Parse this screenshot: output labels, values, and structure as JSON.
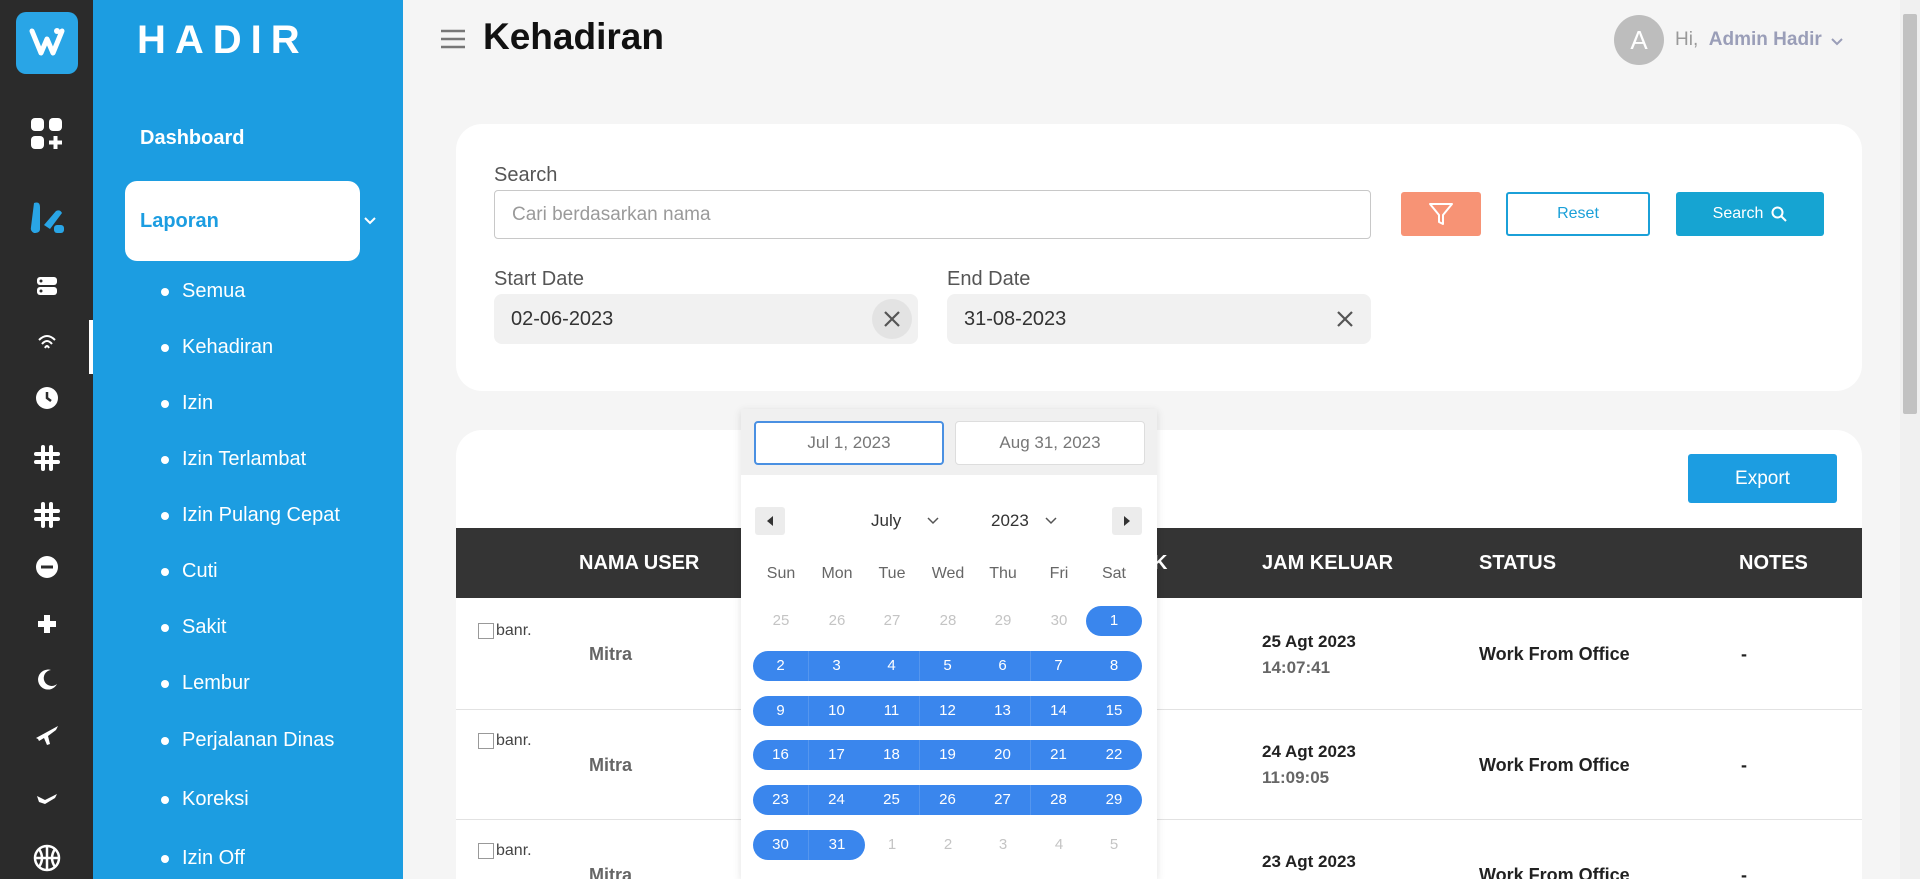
{
  "brand": {
    "name": "HADIR"
  },
  "header": {
    "title": "Kehadiran",
    "avatar_initial": "A",
    "greeting": "Hi,",
    "user_name": "Admin Hadir"
  },
  "menu": {
    "dashboard": "Dashboard",
    "laporan": "Laporan",
    "subitems": [
      "Semua",
      "Kehadiran",
      "Izin",
      "Izin Terlambat",
      "Izin Pulang Cepat",
      "Cuti",
      "Sakit",
      "Lembur",
      "Perjalanan Dinas",
      "Koreksi",
      "Izin Off"
    ]
  },
  "rail_icons": [
    "grid-plus-icon",
    "layout-icon",
    "server-icon",
    "fingerprint-icon",
    "clock-icon",
    "slack-icon",
    "slack-alt-icon",
    "minus-circle-icon",
    "plus-icon",
    "moon-icon",
    "plane-icon",
    "plane-landing-icon",
    "basketball-icon"
  ],
  "filters": {
    "search_label": "Search",
    "search_placeholder": "Cari berdasarkan nama",
    "reset_label": "Reset",
    "search_button": "Search",
    "start_label": "Start Date",
    "start_value": "02-06-2023",
    "end_label": "End Date",
    "end_value": "31-08-2023"
  },
  "table": {
    "export_label": "Export",
    "headers": {
      "nama_user": "NAMA USER",
      "jam_masuk_tail": "K",
      "jam_keluar": "JAM KELUAR",
      "status": "STATUS",
      "notes": "NOTES"
    },
    "img_alt": "banr.",
    "rows": [
      {
        "name": "Mitra",
        "date": "25 Agt 2023",
        "time": "14:07:41",
        "status": "Work From Office",
        "notes": "-"
      },
      {
        "name": "Mitra",
        "date": "24 Agt 2023",
        "time": "11:09:05",
        "status": "Work From Office",
        "notes": "-"
      },
      {
        "name": "Mitra",
        "date": "23 Agt 2023",
        "time": "",
        "status": "Work From Office",
        "notes": "-"
      }
    ]
  },
  "picker": {
    "start": "Jul 1, 2023",
    "end": "Aug 31, 2023",
    "month": "July",
    "year": "2023",
    "weekdays": [
      "Sun",
      "Mon",
      "Tue",
      "Wed",
      "Thu",
      "Fri",
      "Sat"
    ],
    "weeks": [
      [
        "25",
        "26",
        "27",
        "28",
        "29",
        "30",
        "1"
      ],
      [
        "2",
        "3",
        "4",
        "5",
        "6",
        "7",
        "8"
      ],
      [
        "9",
        "10",
        "11",
        "12",
        "13",
        "14",
        "15"
      ],
      [
        "16",
        "17",
        "18",
        "19",
        "20",
        "21",
        "22"
      ],
      [
        "23",
        "24",
        "25",
        "26",
        "27",
        "28",
        "29"
      ],
      [
        "30",
        "31",
        "1",
        "2",
        "3",
        "4",
        "5"
      ]
    ],
    "in_range": [
      [
        false,
        false,
        false,
        false,
        false,
        false,
        true
      ],
      [
        true,
        true,
        true,
        true,
        true,
        true,
        true
      ],
      [
        true,
        true,
        true,
        true,
        true,
        true,
        true
      ],
      [
        true,
        true,
        true,
        true,
        true,
        true,
        true
      ],
      [
        true,
        true,
        true,
        true,
        true,
        true,
        true
      ],
      [
        true,
        true,
        false,
        false,
        false,
        false,
        false
      ]
    ]
  },
  "colors": {
    "accent": "#1c9de1",
    "rail": "#2b2b2b",
    "header_row": "#343434",
    "filter_button": "#f79375",
    "range": "#3a86ed"
  }
}
